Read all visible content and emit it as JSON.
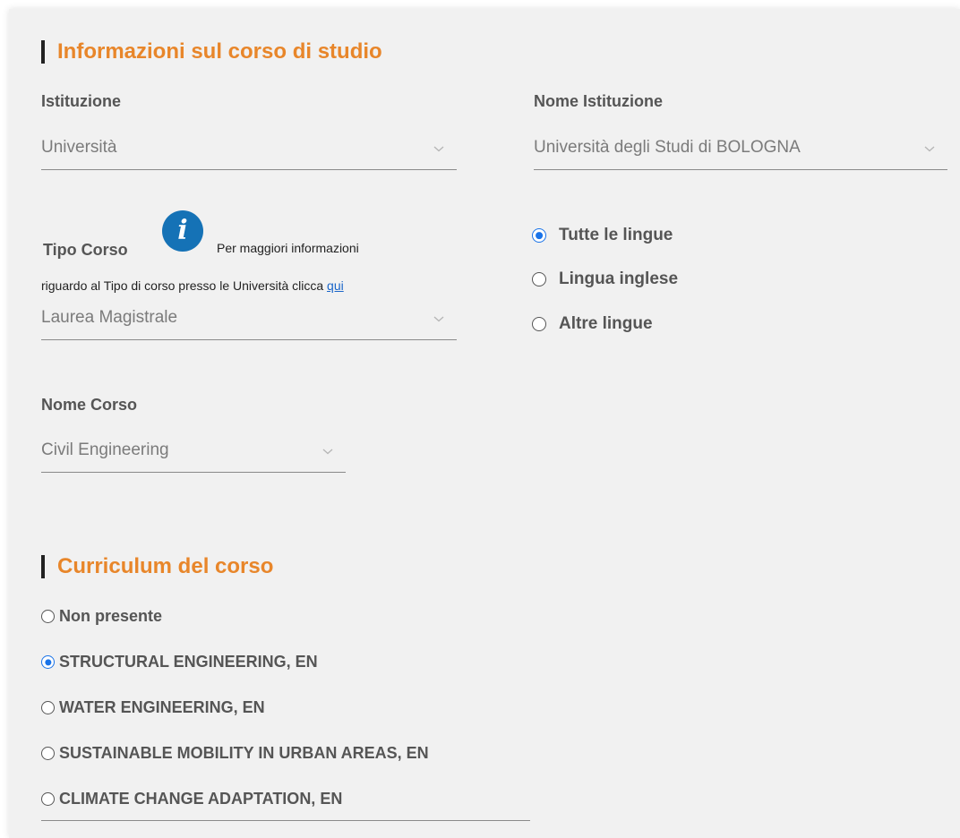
{
  "course_info": {
    "title": "Informazioni sul corso di studio",
    "institution_label": "Istituzione",
    "institution_value": "Università",
    "institution_name_label": "Nome Istituzione",
    "institution_name_value": "Università degli Studi di BOLOGNA",
    "course_type_label": "Tipo Corso",
    "info_icon_glyph": "i",
    "info_text_1": "Per maggiori informazioni",
    "info_text_2": "riguardo al Tipo di corso presso le Università clicca",
    "info_link": "qui",
    "course_type_value": "Laurea Magistrale",
    "course_name_label": "Nome Corso",
    "course_name_value": "Civil Engineering",
    "languages": [
      {
        "label": "Tutte le lingue",
        "checked": true
      },
      {
        "label": "Lingua inglese",
        "checked": false
      },
      {
        "label": "Altre lingue",
        "checked": false
      }
    ]
  },
  "curriculum": {
    "title": "Curriculum del corso",
    "options": [
      {
        "label": "Non presente",
        "checked": false
      },
      {
        "label": "STRUCTURAL ENGINEERING, EN",
        "checked": true
      },
      {
        "label": "WATER ENGINEERING, EN",
        "checked": false
      },
      {
        "label": "SUSTAINABLE MOBILITY IN URBAN AREAS, EN",
        "checked": false
      },
      {
        "label": "CLIMATE CHANGE ADAPTATION, EN",
        "checked": false
      }
    ]
  },
  "colors": {
    "accent": "#e8862a",
    "radio_checked": "#1a73e8",
    "info_icon": "#1572b6",
    "link": "#1a66c9"
  }
}
